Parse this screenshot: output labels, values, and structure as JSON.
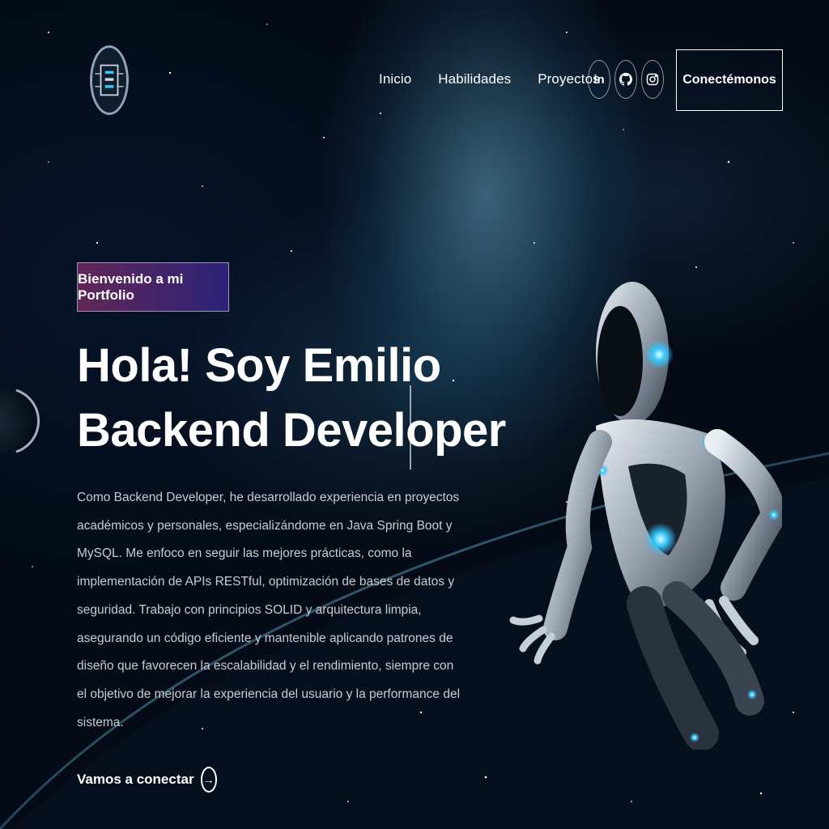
{
  "header": {
    "logo_icon": "circuit-logo-icon",
    "nav": [
      {
        "label": "Inicio"
      },
      {
        "label": "Habilidades"
      },
      {
        "label": "Proyectos"
      }
    ],
    "social": [
      {
        "icon": "linkedin-icon",
        "glyph": "in"
      },
      {
        "icon": "github-icon",
        "glyph": ""
      },
      {
        "icon": "instagram-icon",
        "glyph": ""
      }
    ],
    "connect_label": "Conectémonos"
  },
  "hero": {
    "tagline": "Bienvenido a mi Portfolio",
    "headline_line1": "Hola! Soy Emilio",
    "headline_line2": "Backend Developer",
    "description": "Como Backend Developer, he desarrollado experiencia en proyectos académicos y personales, especializándome en Java Spring Boot y MySQL. Me enfoco en seguir las mejores prácticas, como la implementación de APIs RESTful, optimización de bases de datos y seguridad. Trabajo con principios SOLID y arquitectura limpia, asegurando un código eficiente y mantenible aplicando patrones de diseño que favorecen la escalabilidad y el rendimiento, siempre con el objetivo de mejorar la experiencia del usuario y la performance del sistema.",
    "cta_label": "Vamos a conectar",
    "cta_icon": "arrow-right-circle-icon"
  },
  "colors": {
    "background": "#040a16",
    "tagline_gradient_start": "#aa367c",
    "tagline_gradient_end": "#4a2fbd",
    "robot_accent": "#35c8ff"
  }
}
